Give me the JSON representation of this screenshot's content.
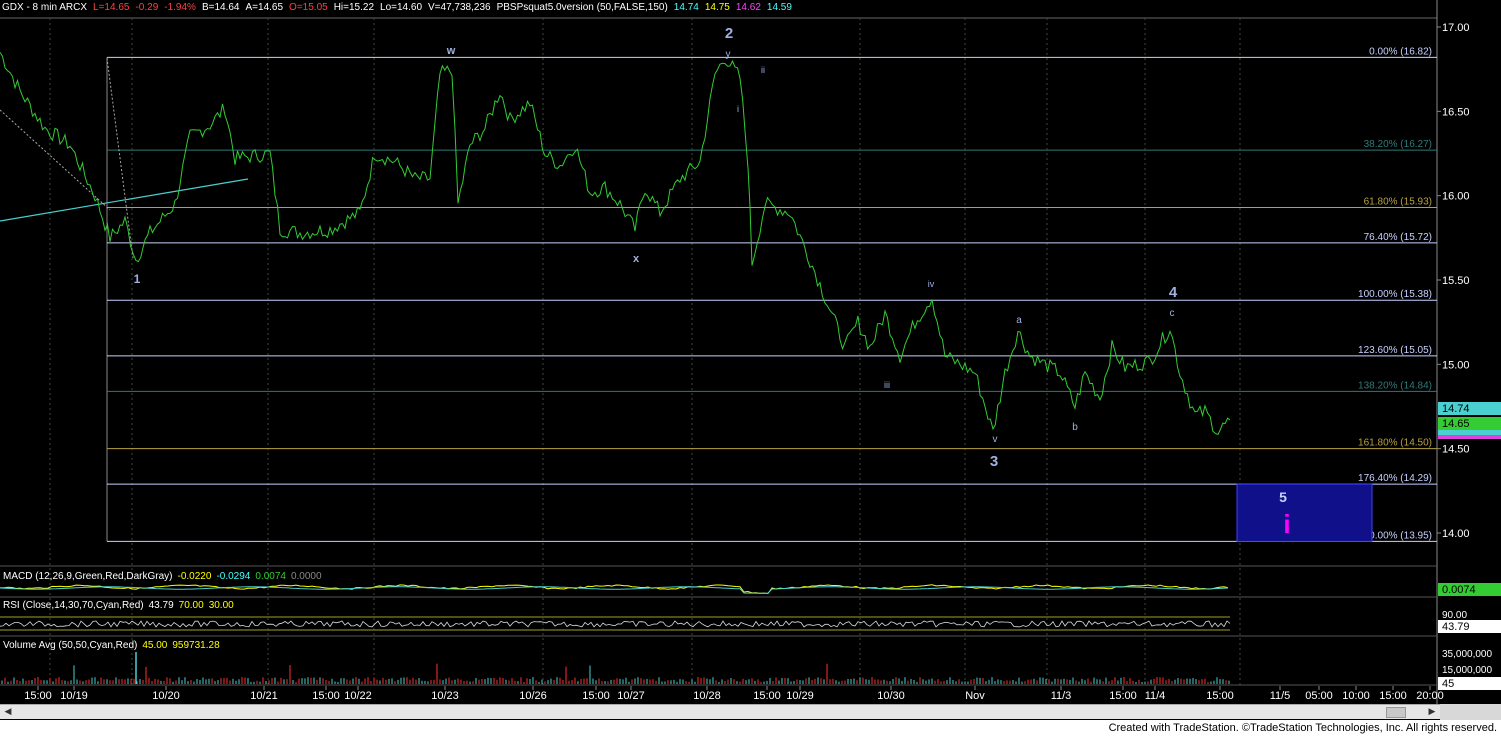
{
  "header": {
    "symbol_line": "GDX - 8 min  ARCX",
    "last": "L=14.65",
    "change": "-0.29",
    "change_pct": "-1.94%",
    "bid": "B=14.64",
    "ask": "A=14.65",
    "open": "O=15.05",
    "high": "Hi=15.22",
    "low": "Lo=14.60",
    "volume": "V=47,738,236",
    "study": "PBSPsquat5.0version (50,FALSE,150)",
    "study_values": [
      "14.74",
      "14.75",
      "14.62",
      "14.59"
    ]
  },
  "colors": {
    "price": "#33cc33",
    "fib_white": "#c8d0ff",
    "fib_teal": "#2e7a7a",
    "fib_gold": "#b8a040",
    "target_box": "#10108a",
    "wave_label": "#a0b0e0",
    "magenta": "#ff00ff"
  },
  "chart_data": {
    "type": "line",
    "title": "GDX - 8 min",
    "y_ticks": [
      "17.00",
      "16.50",
      "16.00",
      "15.50",
      "15.00",
      "14.50",
      "14.00"
    ],
    "ylim": [
      13.8,
      17.05
    ],
    "x_ticks": [
      "15:00",
      "10/19",
      "10/20",
      "10/21",
      "15:00",
      "10/22",
      "10/23",
      "10/26",
      "15:00",
      "10/27",
      "10/28",
      "15:00",
      "10/29",
      "10/30",
      "Nov",
      "11/3",
      "15:00",
      "11/4",
      "15:00",
      "11/5",
      "05:00",
      "10:00",
      "15:00",
      "20:00"
    ],
    "series": [
      {
        "x": [
          "10/16",
          "10/19",
          "10/20",
          "10/21",
          "10/22",
          "10/23",
          "10/26",
          "10/27",
          "10/28",
          "10/29",
          "10/30",
          "Nov",
          "11/3",
          "11/4",
          "11/4"
        ],
        "values": [
          16.85,
          15.62,
          16.52,
          15.75,
          16.25,
          16.75,
          15.8,
          16.1,
          16.82,
          15.6,
          15.1,
          14.6,
          14.75,
          15.22,
          14.65
        ]
      }
    ],
    "fib_levels": [
      {
        "pct": "0.00%",
        "value": 16.82,
        "label": "0.00% (16.82)"
      },
      {
        "pct": "38.20%",
        "value": 16.27,
        "label": "38.20% (16.27)"
      },
      {
        "pct": "61.80%",
        "value": 15.93,
        "label": "61.80% (15.93)"
      },
      {
        "pct": "76.40%",
        "value": 15.72,
        "label": "76.40% (15.72)"
      },
      {
        "pct": "100.00%",
        "value": 15.38,
        "label": "100.00% (15.38)"
      },
      {
        "pct": "123.60%",
        "value": 15.05,
        "label": "123.60% (15.05)"
      },
      {
        "pct": "138.20%",
        "value": 14.84,
        "label": "138.20% (14.84)"
      },
      {
        "pct": "161.80%",
        "value": 14.5,
        "label": "161.80% (14.50)"
      },
      {
        "pct": "176.40%",
        "value": 14.29,
        "label": "176.40% (14.29)"
      },
      {
        "pct": "200.00%",
        "value": 13.95,
        "label": "200.00% (13.95)"
      }
    ],
    "wave_labels": [
      "w",
      "2",
      "y",
      "ii",
      "i",
      "x",
      "1",
      "iv",
      "iii",
      "a",
      "v",
      "3",
      "b",
      "4",
      "c",
      "5",
      "i"
    ],
    "target_box": {
      "from": 14.29,
      "to": 13.95
    },
    "price_badges": [
      "14.74",
      "14.65"
    ]
  },
  "indicators": {
    "macd": {
      "label": "MACD (12,26,9,Green,Red,DarkGray)",
      "values": [
        "-0.0220",
        "-0.0294",
        "0.0074",
        "0.0000"
      ],
      "badge": "0.0074"
    },
    "rsi": {
      "label": "RSI (Close,14,30,70,Cyan,Red)",
      "values": [
        "43.79",
        "70.00",
        "30.00"
      ],
      "badge": "43.79",
      "axis": "90.00"
    },
    "volume": {
      "label": "Volume Avg (50,50,Cyan,Red)",
      "values": [
        "45.00",
        "959731.28"
      ],
      "axis": [
        "35,000,000",
        "15,000,000",
        "45"
      ]
    }
  },
  "footer": {
    "text": "Created with TradeStation. ©TradeStation Technologies, Inc. All rights reserved."
  }
}
